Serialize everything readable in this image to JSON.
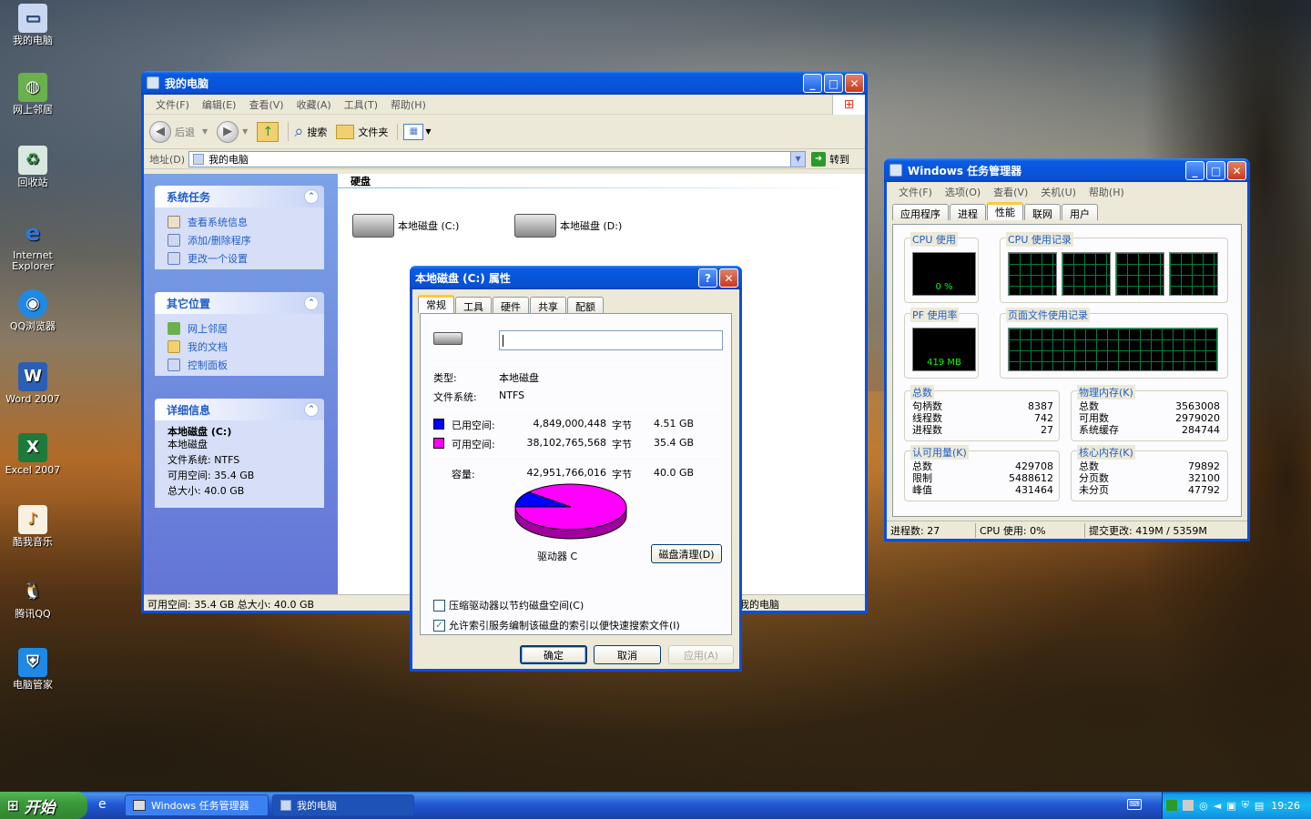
{
  "desktop": {
    "icons": [
      "我的电脑",
      "网上邻居",
      "回收站",
      "Internet Explorer",
      "QQ浏览器",
      "Word 2007",
      "Excel 2007",
      "酷我音乐",
      "腾讯QQ",
      "电脑管家"
    ]
  },
  "explorer": {
    "title": "我的电脑",
    "menu": [
      "文件(F)",
      "编辑(E)",
      "查看(V)",
      "收藏(A)",
      "工具(T)",
      "帮助(H)"
    ],
    "toolbar": {
      "back": "后退",
      "search": "搜索",
      "folders": "文件夹"
    },
    "address_label": "地址(D)",
    "address_value": "我的电脑",
    "go": "转到",
    "system_tasks": {
      "title": "系统任务",
      "items": [
        "查看系统信息",
        "添加/删除程序",
        "更改一个设置"
      ]
    },
    "other_places": {
      "title": "其它位置",
      "items": [
        "网上邻居",
        "我的文档",
        "控制面板"
      ]
    },
    "details": {
      "title": "详细信息",
      "name": "本地磁盘 (C:)",
      "type": "本地磁盘",
      "fs": "文件系统: NTFS",
      "free": "可用空间: 35.4 GB",
      "total": "总大小: 40.0 GB"
    },
    "section": "硬盘",
    "drives": [
      "本地磁盘 (C:)",
      "本地磁盘 (D:)"
    ],
    "status_left": "可用空间: 35.4 GB 总大小: 40.0 GB",
    "status_right": "我的电脑"
  },
  "props": {
    "title": "本地磁盘 (C:) 属性",
    "tabs": [
      "常规",
      "工具",
      "硬件",
      "共享",
      "配额"
    ],
    "name_value": "",
    "type_label": "类型:",
    "type_value": "本地磁盘",
    "fs_label": "文件系统:",
    "fs_value": "NTFS",
    "used_label": "已用空间:",
    "used_bytes": "4,849,000,448",
    "used_unit": "字节",
    "used_gb": "4.51 GB",
    "free_label": "可用空间:",
    "free_bytes": "38,102,765,568",
    "free_unit": "字节",
    "free_gb": "35.4 GB",
    "cap_label": "容量:",
    "cap_bytes": "42,951,766,016",
    "cap_unit": "字节",
    "cap_gb": "40.0 GB",
    "drive_label": "驱动器 C",
    "cleanup": "磁盘清理(D)",
    "compress": "压缩驱动器以节约磁盘空间(C)",
    "index": "允许索引服务编制该磁盘的索引以便快速搜索文件(I)",
    "ok": "确定",
    "cancel": "取消",
    "apply": "应用(A)",
    "colors": {
      "used": "#0000ff",
      "free": "#ff00ff"
    },
    "used_fraction": 0.113
  },
  "taskmgr": {
    "title": "Windows 任务管理器",
    "menu": [
      "文件(F)",
      "选项(O)",
      "查看(V)",
      "关机(U)",
      "帮助(H)"
    ],
    "tabs": [
      "应用程序",
      "进程",
      "性能",
      "联网",
      "用户"
    ],
    "cpu_usage_label": "CPU 使用",
    "cpu_value": "0 %",
    "cpu_history_label": "CPU 使用记录",
    "pf_label": "PF 使用率",
    "pf_value": "419 MB",
    "pf_history_label": "页面文件使用记录",
    "totals": {
      "title": "总数",
      "rows": [
        [
          "句柄数",
          "8387"
        ],
        [
          "线程数",
          "742"
        ],
        [
          "进程数",
          "27"
        ]
      ]
    },
    "physical": {
      "title": "物理内存(K)",
      "rows": [
        [
          "总数",
          "3563008"
        ],
        [
          "可用数",
          "2979020"
        ],
        [
          "系统缓存",
          "284744"
        ]
      ]
    },
    "commit": {
      "title": "认可用量(K)",
      "rows": [
        [
          "总数",
          "429708"
        ],
        [
          "限制",
          "5488612"
        ],
        [
          "峰值",
          "431464"
        ]
      ]
    },
    "kernel": {
      "title": "核心内存(K)",
      "rows": [
        [
          "总数",
          "79892"
        ],
        [
          "分页数",
          "32100"
        ],
        [
          "未分页",
          "47792"
        ]
      ]
    },
    "status": {
      "procs": "进程数: 27",
      "cpu": "CPU 使用: 0%",
      "commit": "提交更改: 419M / 5359M"
    }
  },
  "taskbar": {
    "start": "开始",
    "tasks": [
      "Windows 任务管理器",
      "我的电脑"
    ],
    "time": "19:26"
  }
}
